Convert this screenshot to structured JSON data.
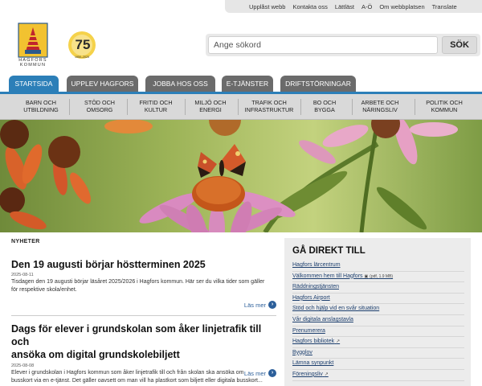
{
  "utility_nav": [
    "Upplåst webb",
    "Kontakta oss",
    "Lättläst",
    "A-Ö",
    "Om webbplatsen",
    "Translate"
  ],
  "logo": {
    "text": "HAGFORS\nKOMMUN",
    "alt": "Hagfors kommun"
  },
  "anniversary": {
    "number": "75",
    "years": "1950–2025"
  },
  "search": {
    "placeholder": "Ange sökord",
    "button_label": "SÖK"
  },
  "tabs": [
    {
      "label": "STARTSIDA",
      "active": true
    },
    {
      "label": "UPPLEV HAGFORS",
      "active": false
    },
    {
      "label": "JOBBA HOS OSS",
      "active": false
    },
    {
      "label": "E-TJÄNSTER",
      "active": false
    },
    {
      "label": "DRIFTSTÖRNINGAR",
      "active": false
    }
  ],
  "subnav": [
    {
      "line1": "BARN OCH",
      "line2": "UTBILDNING"
    },
    {
      "line1": "STÖD OCH",
      "line2": "OMSORG"
    },
    {
      "line1": "FRITID OCH",
      "line2": "KULTUR"
    },
    {
      "line1": "MILJÖ OCH",
      "line2": "ENERGI"
    },
    {
      "line1": "TRAFIK OCH",
      "line2": "INFRASTRUKTUR"
    },
    {
      "line1": "BO OCH",
      "line2": "BYGGA"
    },
    {
      "line1": "ARBETE OCH",
      "line2": "NÄRINGSLIV"
    },
    {
      "line1": "POLITIK OCH",
      "line2": "KOMMUN"
    }
  ],
  "news": {
    "heading": "NYHETER",
    "items": [
      {
        "title": "Den 19 augusti börjar höstterminen 2025",
        "date": "2025-08-11",
        "text_line1": "Tisdagen den 19 augusti börjar läsåret 2025/2026 i Hagfors kommun. Här ser du vilka tider som gäller",
        "text_line2": "för respektive skola/enhet.",
        "more": "Läs mer"
      },
      {
        "title_line1": "Dags för elever i grundskolan som åker linjetrafik till och",
        "title_line2": "ansöka om digital grundskolebiljett",
        "date": "2025-08-08",
        "text_line1": "Elever i grundskolan i Hagfors kommun som åker linjetrafik till och från skolan ska ansöka om",
        "text_line2": "busskort via en e-tjänst. Det gäller oavsett om man vill ha plastkort som biljett eller digitala busskort...",
        "more": "Läs mer"
      }
    ]
  },
  "quick_links": {
    "title": "GÅ DIREKT TILL",
    "items": [
      {
        "label": "Hagfors lärcentrum"
      },
      {
        "label": "Välkommen hem till Hagfors",
        "note": "(pdf, 1.9 MB)"
      },
      {
        "label": "Räddningstjänsten"
      },
      {
        "label": "Hagfors Airport"
      },
      {
        "label": "Stöd och hjälp vid en svår situation"
      },
      {
        "label": "Vår digitala anslagstavla"
      },
      {
        "label": "Prenumerera"
      },
      {
        "label": "Hagfors bibliotek",
        "external": true
      },
      {
        "label": "Bygglov"
      },
      {
        "label": "Lämna synpunkt"
      },
      {
        "label": "Föreningsliv",
        "external": true
      }
    ]
  },
  "colors": {
    "accent": "#2c7fb8",
    "tab": "#6b6b6b",
    "subnav": "#d9d9d9",
    "link": "#1d3f6e"
  }
}
